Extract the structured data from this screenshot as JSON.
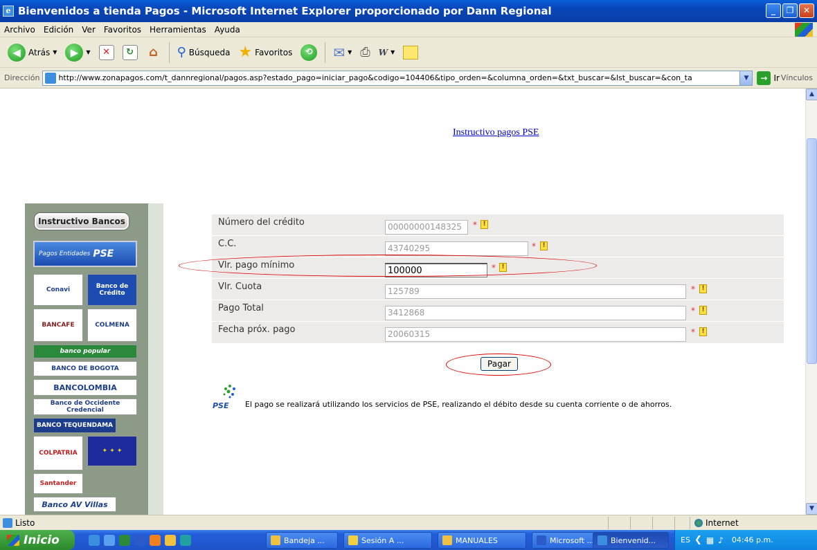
{
  "window": {
    "title": "Bienvenidos a tienda Pagos - Microsoft Internet Explorer proporcionado por Dann Regional"
  },
  "menu": [
    "Archivo",
    "Edición",
    "Ver",
    "Favoritos",
    "Herramientas",
    "Ayuda"
  ],
  "toolbar": {
    "back": "Atrás",
    "search": "Búsqueda",
    "favorites": "Favoritos"
  },
  "address": {
    "label": "Dirección",
    "url": "http://www.zonapagos.com/t_dannregional/pagos.asp?estado_pago=iniciar_pago&codigo=104406&tipo_orden=&columna_orden=&txt_buscar=&lst_buscar=&con_ta",
    "go": "Ir",
    "links": "Vínculos"
  },
  "page": {
    "instr_link": "Instructivo pagos PSE",
    "sidebar": {
      "bancos_button": "Instructivo Bancos",
      "pse_button_text": "Pagos Entidades",
      "pse_brand": "PSE",
      "logos": [
        "Conavi",
        "Banco de Crédito",
        "BANCAFE",
        "COLMENA",
        "banco popular",
        "BANCO DE BOGOTA",
        "BANCOLOMBIA",
        "Banco de Occidente Credencial",
        "BANCO TEQUENDAMA",
        "COLPATRIA",
        "Santander",
        "Banco AV Villas"
      ]
    },
    "form": {
      "rows": [
        {
          "label": "Número del crédito",
          "value": "00000000148325"
        },
        {
          "label": "C.C.",
          "value": "43740295"
        },
        {
          "label": "Vlr. pago mínimo",
          "value": "100000"
        },
        {
          "label": "Vlr. Cuota",
          "value": "125789"
        },
        {
          "label": "Pago Total",
          "value": "3412868"
        },
        {
          "label": "Fecha próx. pago",
          "value": "20060315"
        }
      ],
      "required_mark": "*",
      "help_glyph": "!",
      "submit": "Pagar"
    },
    "pse_note": "El pago se realizará utilizando los servicios de PSE, realizando el débito desde su cuenta corriente o de ahorros.",
    "pse_word": "PSE"
  },
  "status": {
    "text": "Listo",
    "zone": "Internet"
  },
  "taskbar": {
    "start": "Inicio",
    "tasks": [
      "Bandeja ...",
      "Sesión A ...",
      "MANUALES",
      "Microsoft ...",
      "Bienvenid..."
    ],
    "lang": "ES",
    "clock": "04:46 p.m."
  }
}
